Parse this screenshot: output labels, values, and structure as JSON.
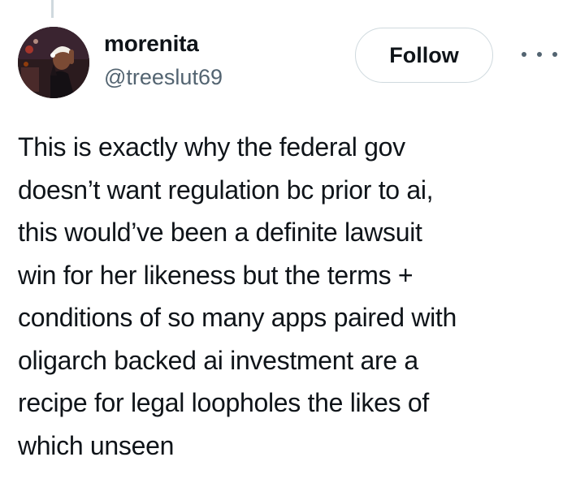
{
  "tweet": {
    "author": {
      "display_name": "morenita",
      "handle": "@treeslut69",
      "avatar_icon": "profile-photo"
    },
    "follow_label": "Follow",
    "more_icon": "more-horizontal-icon",
    "text_lines": [
      "This is exactly why the federal gov",
      "doesn’t want regulation bc prior to ai,",
      "this would’ve been a definite lawsuit",
      "win for her likeness but the terms +",
      "conditions of so many apps paired with",
      "oligarch backed ai investment are a",
      "recipe for legal loopholes the likes of",
      "which unseen"
    ]
  },
  "colors": {
    "text_primary": "#0f1419",
    "text_secondary": "#536471",
    "border": "#cfd9de",
    "background": "#ffffff"
  }
}
